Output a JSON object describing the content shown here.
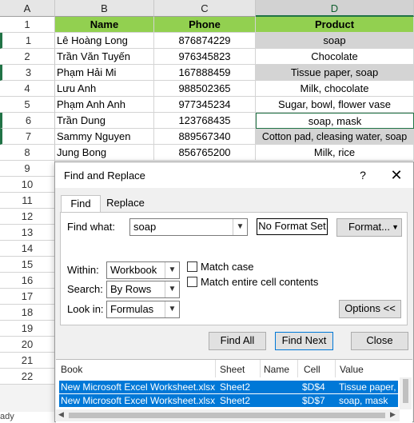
{
  "columns": [
    "A",
    "B",
    "C",
    "D"
  ],
  "header_row": {
    "num": "1",
    "name": "Name",
    "phone": "Phone",
    "product": "Product"
  },
  "rows": [
    {
      "num": "1",
      "name": "Lê Hoàng Long",
      "phone": "876874229",
      "product": "soap"
    },
    {
      "num": "2",
      "name": "Trần Văn Tuyến",
      "phone": "976345823",
      "product": "Chocolate"
    },
    {
      "num": "3",
      "name": "Phạm Hải Mi",
      "phone": "167888459",
      "product": "Tissue paper, soap"
    },
    {
      "num": "4",
      "name": "Lưu Anh",
      "phone": "988502365",
      "product": "Milk, chocolate"
    },
    {
      "num": "5",
      "name": "Phạm Anh Anh",
      "phone": "977345234",
      "product": "Sugar, bowl, flower vase"
    },
    {
      "num": "6",
      "name": "Trần Dung",
      "phone": "123768435",
      "product": "soap, mask"
    },
    {
      "num": "7",
      "name": "Sammy Nguyen",
      "phone": "889567340",
      "product": "Cotton pad, cleasing water, soap"
    },
    {
      "num": "8",
      "name": "Jung Bong",
      "phone": "856765200",
      "product": "Milk, rice"
    }
  ],
  "extra_rows": [
    "9",
    "10",
    "11",
    "12",
    "13",
    "14",
    "15",
    "16",
    "17",
    "18",
    "19",
    "20",
    "21",
    "22"
  ],
  "status_text": "ady",
  "dialog": {
    "title": "Find and Replace",
    "help": "?",
    "close": "✕",
    "tabs": {
      "find": "Find",
      "replace": "Replace"
    },
    "find_what_label": "Find what:",
    "find_what_value": "soap",
    "no_format": "No Format Set",
    "format_btn": "Format...",
    "within_label": "Within:",
    "within_value": "Workbook",
    "search_label": "Search:",
    "search_value": "By Rows",
    "lookin_label": "Look in:",
    "lookin_value": "Formulas",
    "match_case": "Match case",
    "match_entire": "Match entire cell contents",
    "options_btn": "Options <<",
    "find_all": "Find All",
    "find_next": "Find Next",
    "close_btn": "Close",
    "results_headers": {
      "book": "Book",
      "sheet": "Sheet",
      "name": "Name",
      "cell": "Cell",
      "value": "Value"
    },
    "results": [
      {
        "book": "New Microsoft Excel Worksheet.xlsx",
        "sheet": "Sheet2",
        "name": "",
        "cell": "$D$4",
        "value": "Tissue paper, soap"
      },
      {
        "book": "New Microsoft Excel Worksheet.xlsx",
        "sheet": "Sheet2",
        "name": "",
        "cell": "$D$7",
        "value": "soap, mask"
      }
    ]
  },
  "colors": {
    "header_fill": "#92d050",
    "highlight": "#d4d4d4",
    "selection": "#0078d7",
    "excel_green": "#217346"
  }
}
